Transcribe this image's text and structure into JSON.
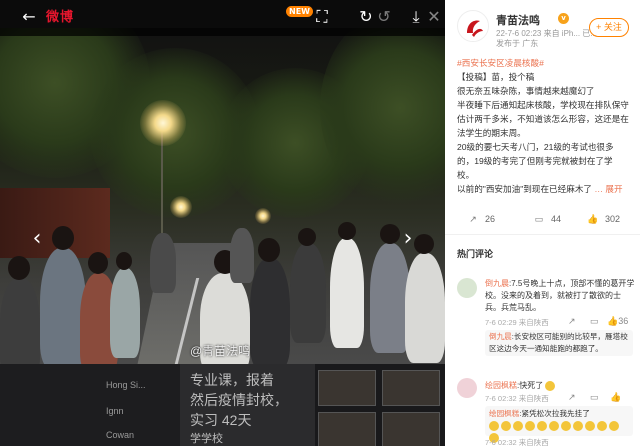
{
  "viewer": {
    "logo": "微博",
    "badge_new": "NEW",
    "watermark": "@青苗法鸣",
    "background_text": {
      "line1": "专业课，报着",
      "line2": "然后疫情封校，",
      "line3": "实习 42天",
      "line4": "学学校",
      "side1": "Hong Si...",
      "side2": "Ignn",
      "side3": "Cowan"
    },
    "icons": [
      "back-arrow-icon",
      "fullscreen-icon",
      "rotate-right-icon",
      "rotate-left-icon",
      "download-icon",
      "close-icon",
      "prev-arrow-icon",
      "next-arrow-icon"
    ]
  },
  "panel": {
    "username": "青苗法鸣",
    "verified_badge": "v",
    "meta": "22-7-6 02:23  来自 iPh... 已...",
    "meta2": "发布于 广东",
    "follow_label": "+ 关注",
    "post": {
      "hashtag": "#西安长安区凌晨核酸#",
      "line1": "【投稿】苗，投个稿",
      "line2": "很无奈五味杂陈，事情越来越魔幻了",
      "line3": "半夜睡下后通知起床核酸，学校现在排队保守",
      "line4": "估计两千多米，不知道该怎么形容，这还是在",
      "line5": "法学生的期末周。",
      "line6": "20级的要七天考八门，21级的考试也很多",
      "line7": "的，19级的考完了但刚考完就被封在了学",
      "line8": "校。",
      "line9": "以前的\"西安加油\"到现在已经麻木了",
      "more": "展开"
    },
    "actions": {
      "share": "26",
      "comment": "44",
      "like": "302"
    },
    "hot_comments_title": "热门评论",
    "comments": [
      {
        "name": "倒九晨",
        "text": ":7.5号晚上十点，顶部不懂的葛开学校。没来的及着到，就被打了散欲的士兵。兵荒马乱。",
        "time": "7-6 02:29  来自陕西",
        "likes": "36",
        "reply_name": "倒九晨",
        "reply_text": ":长安校区可能别的比较早，雁塔校区这边今天一通知能跑的都跑了。"
      },
      {
        "name": "绘园枫糕",
        "text": ":快死了",
        "time": "7-6 02:32  来自陕西",
        "likes": "",
        "reply_name": "绘园枫糕",
        "reply_text": ":紧凭松次拉我先挂了"
      }
    ],
    "third_time": "7-6 02:32  来自陕西"
  }
}
